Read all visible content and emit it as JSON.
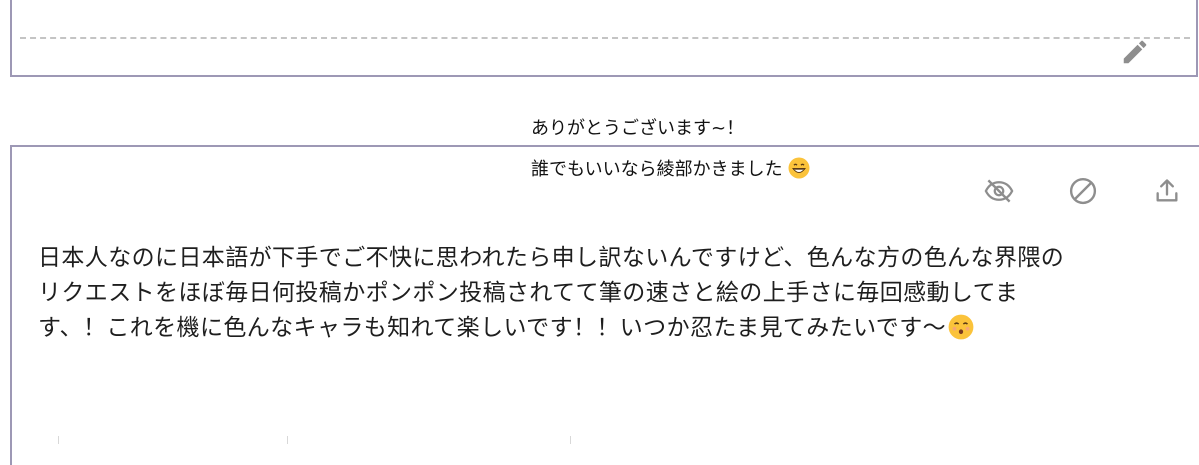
{
  "reply": {
    "line1": "ありがとうございます~！",
    "line2": "誰でもいいなら綾部かきました",
    "line2_emoji": "grinning-face-emoji"
  },
  "message": {
    "text": "日本人なのに日本語が下手でご不快に思われたら申し訳ないんですけど、色んな方の色んな界隈の\nリクエストをほぼ毎日何投稿かポンポン投稿されてて筆の速さと絵の上手さに毎回感動してま\nす、！これを機に色んなキャラも知れて楽しいです！！いつか忍たま見てみたいです〜",
    "emoji": "kissing-face-emoji"
  },
  "icons": {
    "edit": "pencil-icon",
    "hide": "eye-off-icon",
    "block": "block-icon",
    "share": "upload-share-icon"
  },
  "colors": {
    "card_border": "#9d98b5",
    "icon_gray": "#8e8e8e",
    "emoji_yellow": "#fbc33b"
  }
}
